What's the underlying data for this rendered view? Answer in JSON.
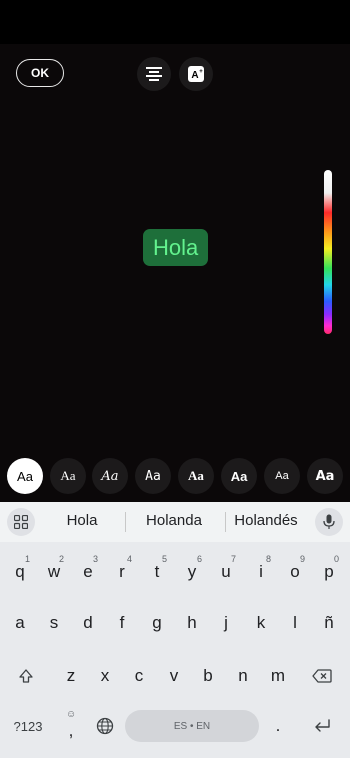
{
  "editor": {
    "ok_label": "OK",
    "text_bubble": "Hola",
    "font_chips": [
      "Aa",
      "Aa",
      "Aa",
      "Aa",
      "Aa",
      "Aa",
      "Aa",
      "Aa"
    ],
    "colors": {
      "bubble_bg": "#1e6f3a",
      "bubble_text": "#63f28e",
      "background": "#0b0809"
    }
  },
  "keyboard": {
    "suggestions": [
      "Hola",
      "Holanda",
      "Holandés"
    ],
    "row1": [
      "q",
      "w",
      "e",
      "r",
      "t",
      "y",
      "u",
      "i",
      "o",
      "p"
    ],
    "row1_nums": [
      "1",
      "2",
      "3",
      "4",
      "5",
      "6",
      "7",
      "8",
      "9",
      "0"
    ],
    "row2": [
      "a",
      "s",
      "d",
      "f",
      "g",
      "h",
      "j",
      "k",
      "l",
      "ñ"
    ],
    "row3": [
      "z",
      "x",
      "c",
      "v",
      "b",
      "n",
      "m"
    ],
    "symbols_label": "?123",
    "comma_label": ",",
    "period_label": ".",
    "space_label": "ES • EN",
    "icons": [
      "apps-grid-icon",
      "mic-icon",
      "shift-icon",
      "backspace-icon",
      "emoji-icon",
      "globe-icon",
      "enter-icon"
    ]
  }
}
